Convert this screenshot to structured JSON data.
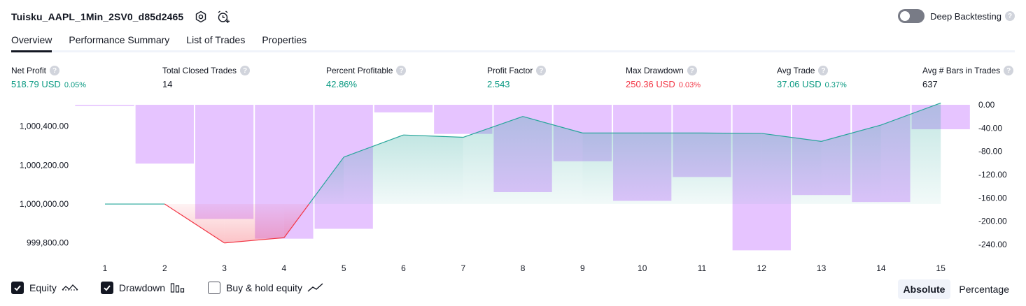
{
  "header": {
    "strategy_title": "Tuisku_AAPL_1Min_2SV0_d85d2465",
    "deep_backtesting_label": "Deep Backtesting",
    "help_glyph": "?"
  },
  "tabs": [
    {
      "label": "Overview",
      "active": true
    },
    {
      "label": "Performance Summary",
      "active": false
    },
    {
      "label": "List of Trades",
      "active": false
    },
    {
      "label": "Properties",
      "active": false
    }
  ],
  "metrics": {
    "net_profit": {
      "label": "Net Profit",
      "value": "518.79 USD",
      "pct": "0.05%",
      "color": "green"
    },
    "total_closed_trades": {
      "label": "Total Closed Trades",
      "value": "14",
      "color": "neutral"
    },
    "percent_profitable": {
      "label": "Percent Profitable",
      "value": "42.86%",
      "color": "green"
    },
    "profit_factor": {
      "label": "Profit Factor",
      "value": "2.543",
      "color": "green"
    },
    "max_drawdown": {
      "label": "Max Drawdown",
      "value": "250.36 USD",
      "pct": "0.03%",
      "color": "red"
    },
    "avg_trade": {
      "label": "Avg Trade",
      "value": "37.06 USD",
      "pct": "0.37%",
      "color": "green"
    },
    "avg_bars": {
      "label": "Avg # Bars in Trades",
      "value": "637",
      "color": "neutral"
    }
  },
  "chart_data": {
    "type": "line",
    "x": [
      1,
      2,
      3,
      4,
      5,
      6,
      7,
      8,
      9,
      10,
      11,
      12,
      13,
      14,
      15
    ],
    "y_left_ticks": [
      "1,000,400.00",
      "1,000,200.00",
      "1,000,000.00",
      "999,800.00"
    ],
    "y_left_tick_values": [
      1000400,
      1000200,
      1000000,
      999800
    ],
    "y_right_ticks": [
      "0.00",
      "-40.00",
      "-80.00",
      "-120.00",
      "-160.00",
      "-200.00",
      "-240.00"
    ],
    "y_right_tick_values": [
      0,
      -40,
      -80,
      -120,
      -160,
      -200,
      -240
    ],
    "ylim_left": [
      999756,
      1000510
    ],
    "ylim_right": [
      -252,
      2
    ],
    "series": [
      {
        "name": "Equity",
        "values": [
          1000000,
          1000000,
          999800,
          999827,
          1000241,
          1000355,
          1000343,
          1000450,
          1000365,
          1000365,
          1000365,
          1000363,
          1000322,
          1000406,
          1000519
        ],
        "color": "#26a69a",
        "negative_color": "#f23645"
      },
      {
        "name": "Drawdown",
        "values": [
          -2,
          -101,
          -196,
          -230,
          -213,
          -13,
          -50,
          -150,
          -97,
          -165,
          -124,
          -250,
          -155,
          -167,
          -42
        ],
        "color": "#c77dff"
      }
    ],
    "baseline_value": 1000000
  },
  "legend": {
    "equity_label": "Equity",
    "drawdown_label": "Drawdown",
    "buyhold_label": "Buy & hold equity",
    "equity_checked": true,
    "drawdown_checked": true,
    "buyhold_checked": false
  },
  "mode": {
    "absolute_label": "Absolute",
    "percentage_label": "Percentage",
    "selected": "Absolute"
  }
}
